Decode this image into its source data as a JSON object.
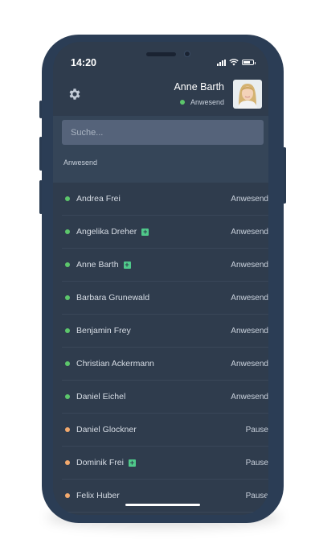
{
  "status_bar": {
    "time": "14:20"
  },
  "header": {
    "user_name": "Anne Barth",
    "user_status": "Anwesend"
  },
  "search": {
    "placeholder": "Suche..."
  },
  "section_label": "Anwesend",
  "colors": {
    "present": "#5cc66b",
    "pause": "#f2a96d",
    "badge": "#4fc98a"
  },
  "people": [
    {
      "name": "Andrea Frei",
      "status": "Anwesend",
      "badge": false,
      "state": "present"
    },
    {
      "name": "Angelika Dreher",
      "status": "Anwesend",
      "badge": true,
      "state": "present"
    },
    {
      "name": "Anne Barth",
      "status": "Anwesend",
      "badge": true,
      "state": "present"
    },
    {
      "name": "Barbara Grunewald",
      "status": "Anwesend",
      "badge": false,
      "state": "present"
    },
    {
      "name": "Benjamin Frey",
      "status": "Anwesend",
      "badge": false,
      "state": "present"
    },
    {
      "name": "Christian Ackermann",
      "status": "Anwesend",
      "badge": false,
      "state": "present"
    },
    {
      "name": "Daniel Eichel",
      "status": "Anwesend",
      "badge": false,
      "state": "present"
    },
    {
      "name": "Daniel Glockner",
      "status": "Pause",
      "badge": false,
      "state": "pause"
    },
    {
      "name": "Dominik Frei",
      "status": "Pause",
      "badge": true,
      "state": "pause"
    },
    {
      "name": "Felix Huber",
      "status": "Pause",
      "badge": false,
      "state": "pause"
    }
  ]
}
